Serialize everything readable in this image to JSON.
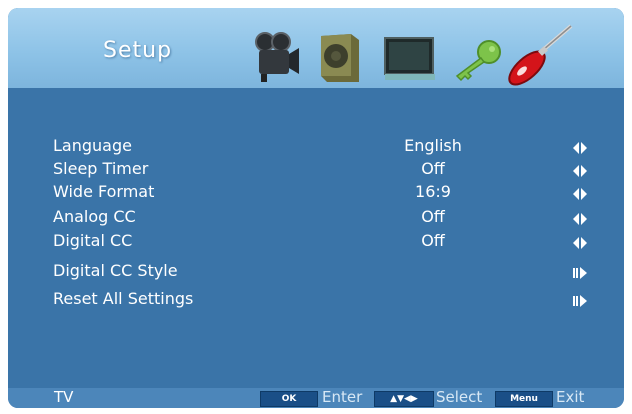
{
  "header": {
    "title": "Setup",
    "icons": [
      "video-camera-icon",
      "speaker-icon",
      "monitor-icon",
      "key-icon",
      "screwdriver-icon"
    ]
  },
  "menu": {
    "items": [
      {
        "label": "Language",
        "value": "English",
        "arrow": "left-right"
      },
      {
        "label": "Sleep Timer",
        "value": "Off",
        "arrow": "left-right"
      },
      {
        "label": "Wide Format",
        "value": "16:9",
        "arrow": "left-right"
      },
      {
        "label": "Analog CC",
        "value": "Off",
        "arrow": "left-right"
      },
      {
        "label": "Digital CC",
        "value": "Off",
        "arrow": "left-right"
      },
      {
        "label": "Digital CC Style",
        "value": "",
        "arrow": "enter"
      },
      {
        "label": "Reset All Settings",
        "value": "",
        "arrow": "enter"
      }
    ]
  },
  "footer": {
    "source": "TV",
    "ok_key": "OK",
    "enter_label": "Enter",
    "nav_key": "▲▼◀▶",
    "select_label": "Select",
    "menu_key": "Menu",
    "exit_label": "Exit"
  },
  "colors": {
    "header_bg": "#8ec3e7",
    "body_bg": "#3a74a8",
    "footer_bg": "#4c86ba",
    "key_bg": "#1a4f87",
    "text": "#ffffff"
  }
}
